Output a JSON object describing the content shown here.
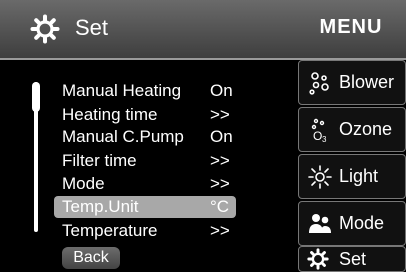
{
  "header": {
    "title": "Set",
    "icon": "gear-icon"
  },
  "menu": [
    {
      "label": "Manual Heating",
      "value": "On"
    },
    {
      "label": "Heating time",
      "value": ">>"
    },
    {
      "label": "Manual C.Pump",
      "value": "On"
    },
    {
      "label": "Filter time",
      "value": ">>"
    },
    {
      "label": "Mode",
      "value": ">>"
    },
    {
      "label": "Temp.Unit",
      "value": "°C",
      "selected": true
    },
    {
      "label": "Temperature",
      "value": ">>"
    }
  ],
  "back_label": "Back",
  "sidebar": {
    "title": "MENU",
    "items": [
      {
        "label": "Blower",
        "icon": "blower-icon"
      },
      {
        "label": "Ozone",
        "icon": "ozone-icon"
      },
      {
        "label": "Light",
        "icon": "light-icon"
      },
      {
        "label": "Mode",
        "icon": "mode-icon"
      },
      {
        "label": "Set",
        "icon": "gear-icon"
      }
    ]
  }
}
